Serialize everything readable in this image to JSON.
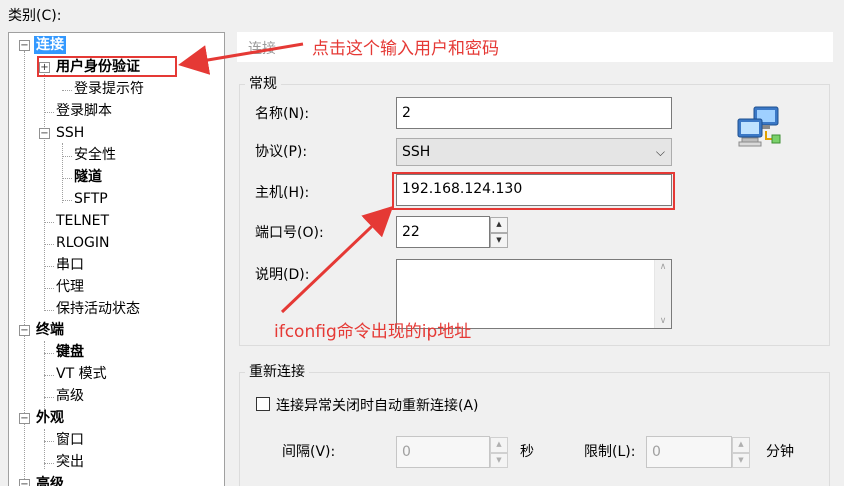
{
  "category_label": "类别(C):",
  "tree": {
    "nodes": [
      {
        "label": "连接",
        "expander": "−"
      },
      {
        "label": "用户身份验证",
        "expander": "+"
      },
      {
        "label": "登录提示符"
      },
      {
        "label": "登录脚本"
      },
      {
        "label": "SSH",
        "expander": "−"
      },
      {
        "label": "安全性"
      },
      {
        "label": "隧道"
      },
      {
        "label": "SFTP"
      },
      {
        "label": "TELNET"
      },
      {
        "label": "RLOGIN"
      },
      {
        "label": "串口"
      },
      {
        "label": "代理"
      },
      {
        "label": "保持活动状态"
      },
      {
        "label": "终端",
        "expander": "−"
      },
      {
        "label": "键盘"
      },
      {
        "label": "VT 模式"
      },
      {
        "label": "高级"
      },
      {
        "label": "外观",
        "expander": "−"
      },
      {
        "label": "窗口"
      },
      {
        "label": "突出"
      },
      {
        "label": "高级",
        "expander": "−"
      }
    ]
  },
  "content": {
    "title": "连接",
    "general": {
      "group_title": "常规",
      "name_label": "名称(N):",
      "name_value": "2",
      "protocol_label": "协议(P):",
      "protocol_value": "SSH",
      "host_label": "主机(H):",
      "host_value": "192.168.124.130",
      "port_label": "端口号(O):",
      "port_value": "22",
      "description_label": "说明(D):",
      "description_value": ""
    },
    "reconnect": {
      "group_title": "重新连接",
      "auto_reconnect_label": "连接异常关闭时自动重新连接(A)",
      "auto_reconnect_checked": false,
      "interval_label": "间隔(V):",
      "interval_value": "0",
      "seconds_unit": "秒",
      "limit_label": "限制(L):",
      "limit_value": "0",
      "minutes_unit": "分钟"
    }
  },
  "annotations": {
    "top_note": "点击这个输入用户和密码",
    "ip_note": "ifconfig命令出现的ip地址",
    "color": "#e53935"
  },
  "icons": {
    "network": "network-computers-icon",
    "dropdown": "chevron-down-icon"
  }
}
